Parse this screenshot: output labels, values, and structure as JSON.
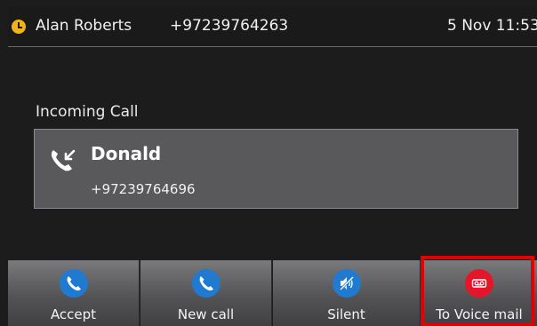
{
  "status_bar": {
    "account_name": "Alan Roberts",
    "account_number": "+97239764263",
    "datetime": "5 Nov 11:53",
    "status_icon": "clock-icon",
    "status_color": "#f0b419"
  },
  "call": {
    "heading": "Incoming Call",
    "caller_name": "Donald",
    "caller_number": "+97239764696",
    "icon": "incoming-call-icon"
  },
  "softkeys": [
    {
      "label": "Accept",
      "icon": "phone-icon",
      "color": "#1f7ad0"
    },
    {
      "label": "New call",
      "icon": "phone-icon",
      "color": "#1f7ad0"
    },
    {
      "label": "Silent",
      "icon": "speaker-muted-icon",
      "color": "#1f7ad0"
    },
    {
      "label": "To Voice mail",
      "icon": "voicemail-icon",
      "color": "#e5162a"
    }
  ]
}
